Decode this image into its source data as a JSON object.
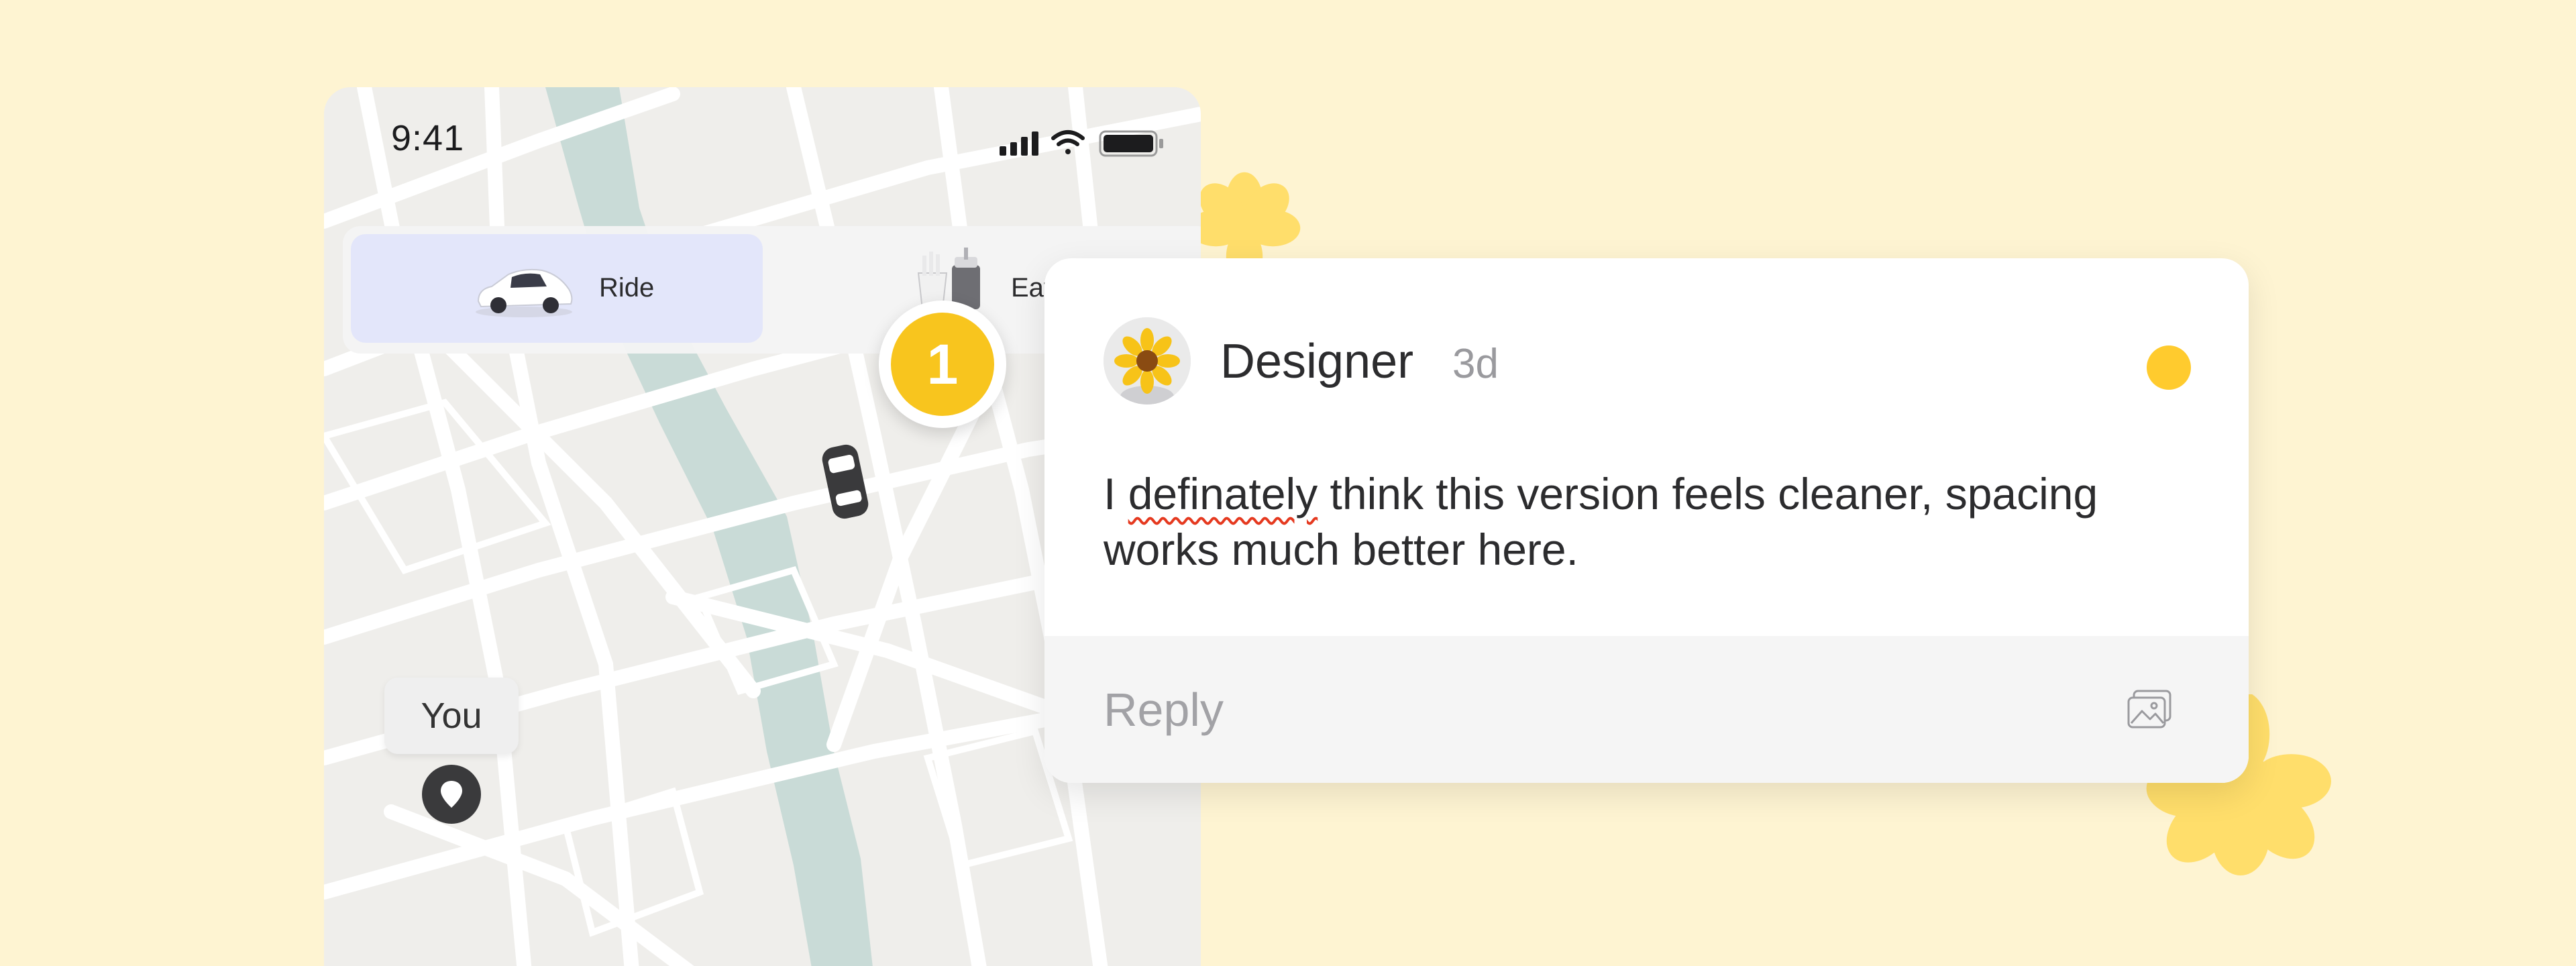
{
  "status_bar": {
    "time": "9:41"
  },
  "tabs": [
    {
      "label": "Ride",
      "icon": "car-icon",
      "active": true
    },
    {
      "label": "Eat",
      "icon": "food-icon",
      "active": false
    }
  ],
  "map": {
    "you_label": "You"
  },
  "badge": {
    "count": "1"
  },
  "comment": {
    "author": "Designer",
    "time_ago": "3d",
    "text_pre": "I ",
    "text_misspelled": "definately",
    "text_post": " think this version feels cleaner, spacing works much better here.",
    "avatar_icon": "sunflower-icon"
  },
  "reply": {
    "placeholder": "Reply",
    "attach_icon": "image-icon"
  },
  "colors": {
    "background": "#FEF4D2",
    "accent": "#F8C51E",
    "ride_tab": "#E3E6FA",
    "map_water": "#C9DBD7",
    "map_ground": "#EFEEEB"
  }
}
